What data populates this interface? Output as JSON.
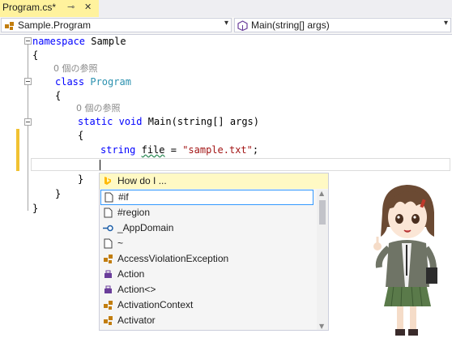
{
  "tab": {
    "title": "Program.cs*",
    "pin_icon": "pin-icon",
    "close_icon": "close-icon"
  },
  "nav": {
    "left_combo": "Sample.Program",
    "right_combo": "Main(string[] args)",
    "left_icon": "class-icon",
    "right_icon": "method-icon"
  },
  "code": {
    "l1_kw": "namespace",
    "l1_name": " Sample",
    "l2": "{",
    "lens1": "0 個の参照",
    "l3_kw": "class",
    "l3_name": "Program",
    "l4": "{",
    "lens2": "0 個の参照",
    "l5_kw1": "static",
    "l5_kw2": "void",
    "l5_rest": " Main(string[] args)",
    "l6": "{",
    "l7_kw": "string",
    "l7_var": "file",
    "l7_eq": " = ",
    "l7_str": "\"sample.txt\"",
    "l7_end": ";",
    "l9": "}",
    "l10": "}",
    "l11": "}"
  },
  "intellisense": {
    "header": "How do I ...",
    "items": [
      {
        "label": "#if",
        "icon": "snippet-icon"
      },
      {
        "label": "#region",
        "icon": "snippet-icon"
      },
      {
        "label": "_AppDomain",
        "icon": "interface-icon"
      },
      {
        "label": "~",
        "icon": "snippet-icon"
      },
      {
        "label": "AccessViolationException",
        "icon": "class-icon"
      },
      {
        "label": "Action",
        "icon": "delegate-icon"
      },
      {
        "label": "Action<>",
        "icon": "delegate-icon"
      },
      {
        "label": "ActivationContext",
        "icon": "class-icon"
      },
      {
        "label": "Activator",
        "icon": "class-icon"
      }
    ]
  }
}
